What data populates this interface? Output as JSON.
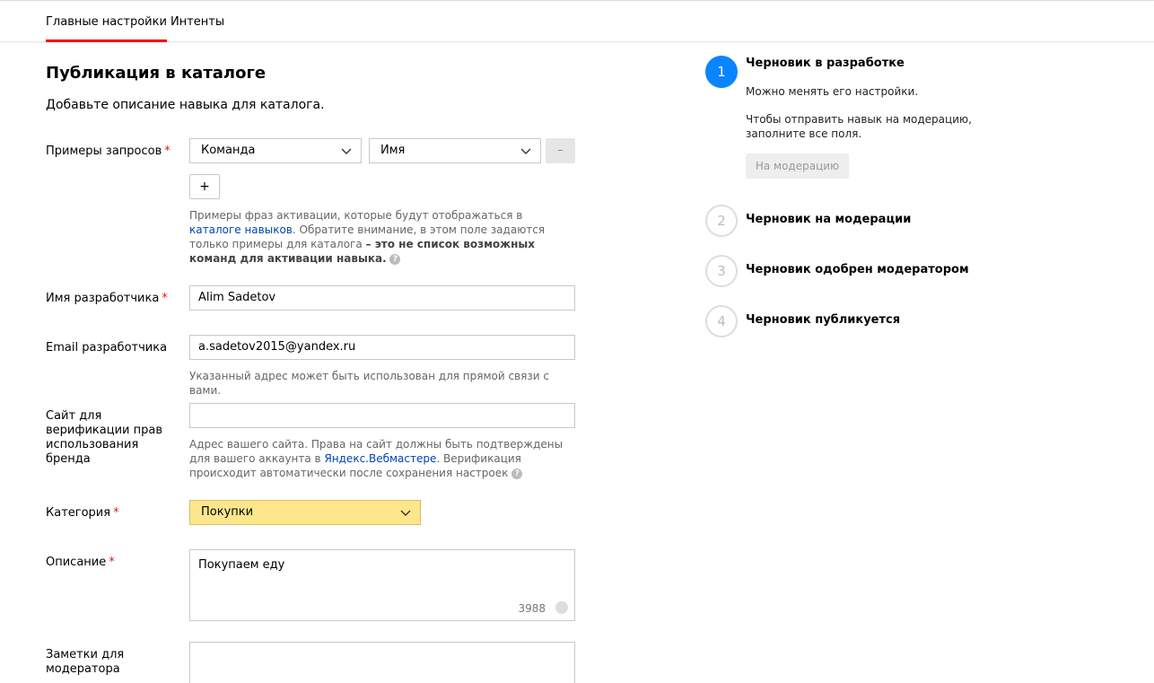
{
  "tabs": [
    {
      "label": "Главные настройки",
      "active": true
    },
    {
      "label": "Интенты",
      "active": false
    }
  ],
  "page": {
    "title": "Публикация в каталоге",
    "subtitle": "Добавьте описание навыка для каталога."
  },
  "form": {
    "examples": {
      "label": "Примеры запросов",
      "required_mark": "*",
      "select1_value": "Команда",
      "select2_value": "Имя",
      "remove_label": "–",
      "add_label": "+",
      "hint_part1": "Примеры фраз активации, которые будут отображаться в ",
      "hint_link": "каталоге навыков",
      "hint_part2": ". Обратите внимание, в этом поле задаются только примеры для каталога ",
      "hint_bold": "– это не список возможных команд для активации навыка.",
      "help_icon": "?"
    },
    "developer_name": {
      "label": "Имя разработчика",
      "required_mark": "*",
      "value": "Alim Sadetov"
    },
    "developer_email": {
      "label": "Email разработчика",
      "value": "a.sadetov2015@yandex.ru",
      "hint": "Указанный адрес может быть использован для прямой связи с вами."
    },
    "site": {
      "label": "Сайт для верификации прав использования бренда",
      "value": "",
      "hint_part1": "Адрес вашего сайта. Права на сайт должны быть подтверждены для вашего аккаунта в ",
      "hint_link": "Яндекс.Вебмастере",
      "hint_part2": ". Верификация происходит автоматически после сохранения настроек ",
      "help_icon": "?"
    },
    "category": {
      "label": "Категория",
      "required_mark": "*",
      "value": "Покупки"
    },
    "description": {
      "label": "Описание",
      "required_mark": "*",
      "value": "Покупаем еду",
      "counter": "3988"
    },
    "notes": {
      "label": "Заметки для модератора",
      "value": ""
    }
  },
  "steps": [
    {
      "number": "1",
      "title": "Черновик в разработке",
      "active": true
    },
    {
      "number": "2",
      "title": "Черновик на модерации",
      "active": false
    },
    {
      "number": "3",
      "title": "Черновик одобрен модератором",
      "active": false
    },
    {
      "number": "4",
      "title": "Черновик публикуется",
      "active": false
    }
  ],
  "step1_details": {
    "text1": "Можно менять его настройки.",
    "text2": "Чтобы отправить навык на модерацию, заполните все поля.",
    "button": "На модерацию"
  },
  "colors": {
    "accent_red": "#ff0000",
    "step_active": "#0a84ff",
    "category_bg": "#fde68c",
    "link": "#0044bb"
  }
}
